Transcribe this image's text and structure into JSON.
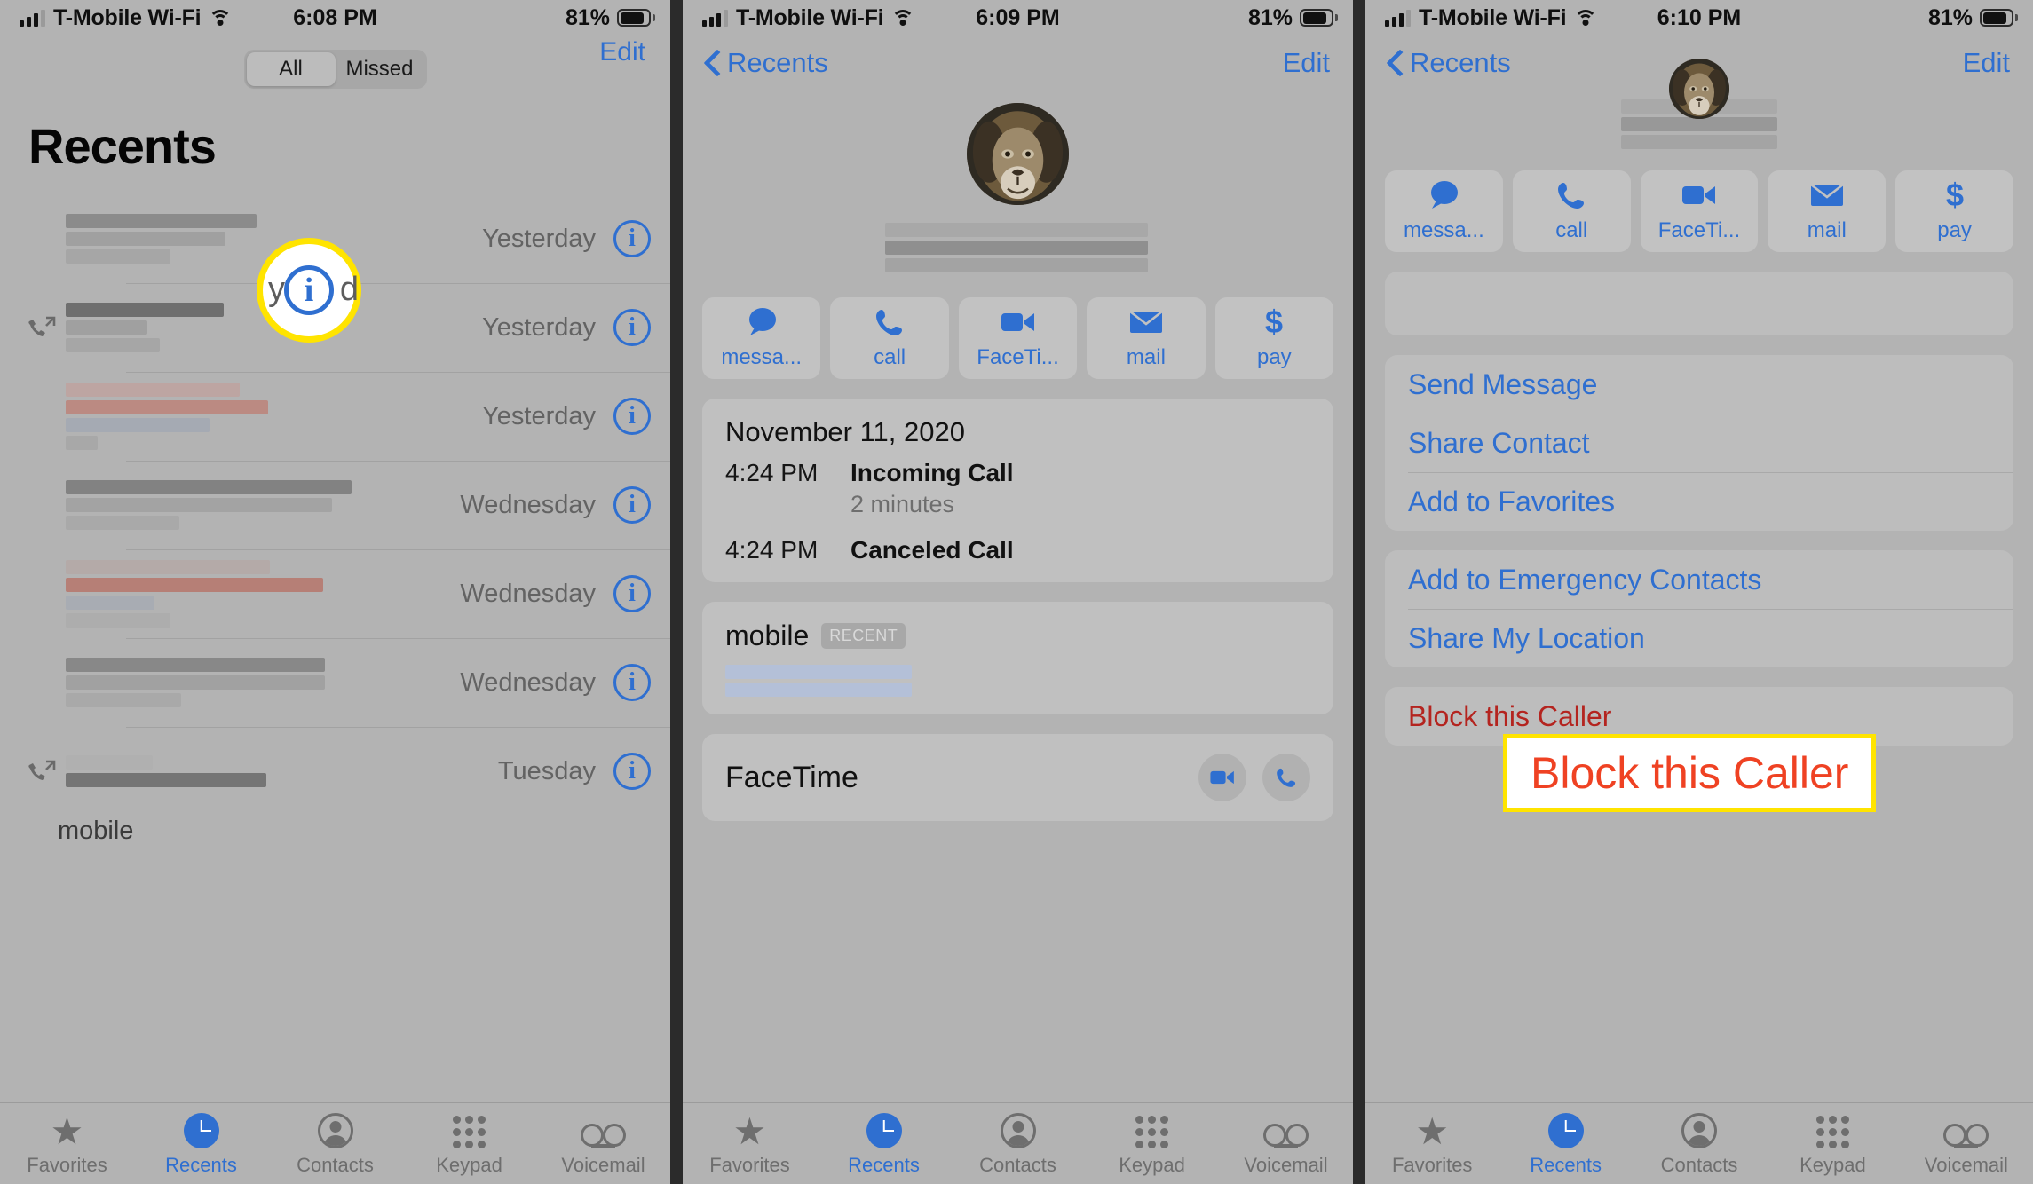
{
  "panels": [
    {
      "id": "recents-list",
      "status": {
        "carrier": "T-Mobile Wi-Fi",
        "time": "6:08 PM",
        "battery": "81%"
      },
      "segmented": {
        "all": "All",
        "missed": "Missed"
      },
      "edit": "Edit",
      "title": "Recents",
      "rows": [
        {
          "time": "Yesterday",
          "outgoing": false,
          "redacted": true
        },
        {
          "time": "Yesterday",
          "outgoing": true,
          "redacted": true
        },
        {
          "time": "Yesterday",
          "outgoing": false,
          "redacted": true
        },
        {
          "time": "Wednesday",
          "outgoing": false,
          "redacted": true
        },
        {
          "time": "Wednesday",
          "outgoing": false,
          "redacted": true
        },
        {
          "time": "Wednesday",
          "outgoing": false,
          "redacted": true
        },
        {
          "time": "Tuesday",
          "outgoing": true,
          "redacted": true,
          "sublabel": "mobile"
        }
      ],
      "magnifier": {
        "icon": "info-icon",
        "ghost_left": "y",
        "ghost_right": "d"
      },
      "tabs": [
        {
          "label": "Favorites",
          "icon": "star-icon",
          "active": false
        },
        {
          "label": "Recents",
          "icon": "clock-icon",
          "active": true
        },
        {
          "label": "Contacts",
          "icon": "contact-icon",
          "active": false
        },
        {
          "label": "Keypad",
          "icon": "keypad-icon",
          "active": false
        },
        {
          "label": "Voicemail",
          "icon": "voicemail-icon",
          "active": false
        }
      ]
    },
    {
      "id": "contact-detail",
      "status": {
        "carrier": "T-Mobile Wi-Fi",
        "time": "6:09 PM",
        "battery": "81%"
      },
      "back": "Recents",
      "edit": "Edit",
      "avatar": "lion-avatar",
      "actions": [
        {
          "label": "messa...",
          "icon": "message-bubble-icon"
        },
        {
          "label": "call",
          "icon": "phone-icon"
        },
        {
          "label": "FaceTi...",
          "icon": "video-camera-icon"
        },
        {
          "label": "mail",
          "icon": "envelope-icon"
        },
        {
          "label": "pay",
          "icon": "dollar-icon"
        }
      ],
      "call_history": {
        "date": "November 11, 2020",
        "entries": [
          {
            "time": "4:24 PM",
            "kind": "Incoming Call",
            "duration": "2 minutes"
          },
          {
            "time": "4:24 PM",
            "kind": "Canceled Call",
            "duration": ""
          }
        ]
      },
      "phone": {
        "label": "mobile",
        "badge": "RECENT"
      },
      "facetime": {
        "label": "FaceTime",
        "video_icon": "video-camera-icon",
        "audio_icon": "phone-icon"
      },
      "tabs": [
        {
          "label": "Favorites",
          "icon": "star-icon",
          "active": false
        },
        {
          "label": "Recents",
          "icon": "clock-icon",
          "active": true
        },
        {
          "label": "Contacts",
          "icon": "contact-icon",
          "active": false
        },
        {
          "label": "Keypad",
          "icon": "keypad-icon",
          "active": false
        },
        {
          "label": "Voicemail",
          "icon": "voicemail-icon",
          "active": false
        }
      ]
    },
    {
      "id": "contact-actions",
      "status": {
        "carrier": "T-Mobile Wi-Fi",
        "time": "6:10 PM",
        "battery": "81%"
      },
      "back": "Recents",
      "edit": "Edit",
      "avatar": "lion-avatar",
      "actions": [
        {
          "label": "messa...",
          "icon": "message-bubble-icon"
        },
        {
          "label": "call",
          "icon": "phone-icon"
        },
        {
          "label": "FaceTi...",
          "icon": "video-camera-icon"
        },
        {
          "label": "mail",
          "icon": "envelope-icon"
        },
        {
          "label": "pay",
          "icon": "dollar-icon"
        }
      ],
      "menu_group_1": [
        "Send Message",
        "Share Contact",
        "Add to Favorites"
      ],
      "menu_group_2": [
        "Add to Emergency Contacts",
        "Share My Location"
      ],
      "menu_group_3": [
        "Block this Caller"
      ],
      "callout": {
        "text": "Block this Caller",
        "border": "#ffe400",
        "text_color": "#ef4223"
      },
      "tabs": [
        {
          "label": "Favorites",
          "icon": "star-icon",
          "active": false
        },
        {
          "label": "Recents",
          "icon": "clock-icon",
          "active": true
        },
        {
          "label": "Contacts",
          "icon": "contact-icon",
          "active": false
        },
        {
          "label": "Keypad",
          "icon": "keypad-icon",
          "active": false
        },
        {
          "label": "Voicemail",
          "icon": "voicemail-icon",
          "active": false
        }
      ]
    }
  ],
  "colors": {
    "accent": "#2f6fd0",
    "danger": "#b4241f",
    "highlight": "#ffe400",
    "callout_text": "#ef4223"
  }
}
